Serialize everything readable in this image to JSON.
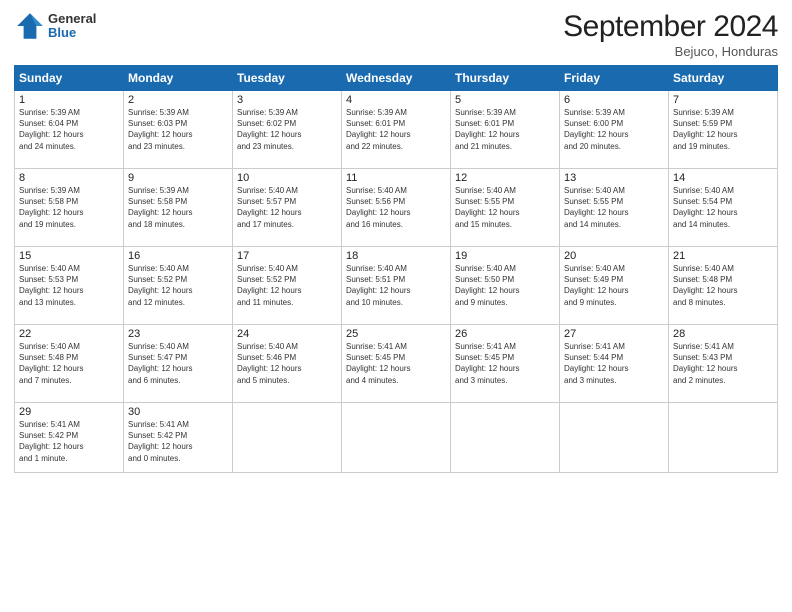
{
  "header": {
    "logo_general": "General",
    "logo_blue": "Blue",
    "month_year": "September 2024",
    "location": "Bejuco, Honduras"
  },
  "days_of_week": [
    "Sunday",
    "Monday",
    "Tuesday",
    "Wednesday",
    "Thursday",
    "Friday",
    "Saturday"
  ],
  "weeks": [
    [
      {
        "day": "1",
        "info": "Sunrise: 5:39 AM\nSunset: 6:04 PM\nDaylight: 12 hours\nand 24 minutes."
      },
      {
        "day": "2",
        "info": "Sunrise: 5:39 AM\nSunset: 6:03 PM\nDaylight: 12 hours\nand 23 minutes."
      },
      {
        "day": "3",
        "info": "Sunrise: 5:39 AM\nSunset: 6:02 PM\nDaylight: 12 hours\nand 23 minutes."
      },
      {
        "day": "4",
        "info": "Sunrise: 5:39 AM\nSunset: 6:01 PM\nDaylight: 12 hours\nand 22 minutes."
      },
      {
        "day": "5",
        "info": "Sunrise: 5:39 AM\nSunset: 6:01 PM\nDaylight: 12 hours\nand 21 minutes."
      },
      {
        "day": "6",
        "info": "Sunrise: 5:39 AM\nSunset: 6:00 PM\nDaylight: 12 hours\nand 20 minutes."
      },
      {
        "day": "7",
        "info": "Sunrise: 5:39 AM\nSunset: 5:59 PM\nDaylight: 12 hours\nand 19 minutes."
      }
    ],
    [
      {
        "day": "8",
        "info": "Sunrise: 5:39 AM\nSunset: 5:58 PM\nDaylight: 12 hours\nand 19 minutes."
      },
      {
        "day": "9",
        "info": "Sunrise: 5:39 AM\nSunset: 5:58 PM\nDaylight: 12 hours\nand 18 minutes."
      },
      {
        "day": "10",
        "info": "Sunrise: 5:40 AM\nSunset: 5:57 PM\nDaylight: 12 hours\nand 17 minutes."
      },
      {
        "day": "11",
        "info": "Sunrise: 5:40 AM\nSunset: 5:56 PM\nDaylight: 12 hours\nand 16 minutes."
      },
      {
        "day": "12",
        "info": "Sunrise: 5:40 AM\nSunset: 5:55 PM\nDaylight: 12 hours\nand 15 minutes."
      },
      {
        "day": "13",
        "info": "Sunrise: 5:40 AM\nSunset: 5:55 PM\nDaylight: 12 hours\nand 14 minutes."
      },
      {
        "day": "14",
        "info": "Sunrise: 5:40 AM\nSunset: 5:54 PM\nDaylight: 12 hours\nand 14 minutes."
      }
    ],
    [
      {
        "day": "15",
        "info": "Sunrise: 5:40 AM\nSunset: 5:53 PM\nDaylight: 12 hours\nand 13 minutes."
      },
      {
        "day": "16",
        "info": "Sunrise: 5:40 AM\nSunset: 5:52 PM\nDaylight: 12 hours\nand 12 minutes."
      },
      {
        "day": "17",
        "info": "Sunrise: 5:40 AM\nSunset: 5:52 PM\nDaylight: 12 hours\nand 11 minutes."
      },
      {
        "day": "18",
        "info": "Sunrise: 5:40 AM\nSunset: 5:51 PM\nDaylight: 12 hours\nand 10 minutes."
      },
      {
        "day": "19",
        "info": "Sunrise: 5:40 AM\nSunset: 5:50 PM\nDaylight: 12 hours\nand 9 minutes."
      },
      {
        "day": "20",
        "info": "Sunrise: 5:40 AM\nSunset: 5:49 PM\nDaylight: 12 hours\nand 9 minutes."
      },
      {
        "day": "21",
        "info": "Sunrise: 5:40 AM\nSunset: 5:48 PM\nDaylight: 12 hours\nand 8 minutes."
      }
    ],
    [
      {
        "day": "22",
        "info": "Sunrise: 5:40 AM\nSunset: 5:48 PM\nDaylight: 12 hours\nand 7 minutes."
      },
      {
        "day": "23",
        "info": "Sunrise: 5:40 AM\nSunset: 5:47 PM\nDaylight: 12 hours\nand 6 minutes."
      },
      {
        "day": "24",
        "info": "Sunrise: 5:40 AM\nSunset: 5:46 PM\nDaylight: 12 hours\nand 5 minutes."
      },
      {
        "day": "25",
        "info": "Sunrise: 5:41 AM\nSunset: 5:45 PM\nDaylight: 12 hours\nand 4 minutes."
      },
      {
        "day": "26",
        "info": "Sunrise: 5:41 AM\nSunset: 5:45 PM\nDaylight: 12 hours\nand 3 minutes."
      },
      {
        "day": "27",
        "info": "Sunrise: 5:41 AM\nSunset: 5:44 PM\nDaylight: 12 hours\nand 3 minutes."
      },
      {
        "day": "28",
        "info": "Sunrise: 5:41 AM\nSunset: 5:43 PM\nDaylight: 12 hours\nand 2 minutes."
      }
    ],
    [
      {
        "day": "29",
        "info": "Sunrise: 5:41 AM\nSunset: 5:42 PM\nDaylight: 12 hours\nand 1 minute."
      },
      {
        "day": "30",
        "info": "Sunrise: 5:41 AM\nSunset: 5:42 PM\nDaylight: 12 hours\nand 0 minutes."
      },
      {
        "day": "",
        "info": ""
      },
      {
        "day": "",
        "info": ""
      },
      {
        "day": "",
        "info": ""
      },
      {
        "day": "",
        "info": ""
      },
      {
        "day": "",
        "info": ""
      }
    ]
  ]
}
